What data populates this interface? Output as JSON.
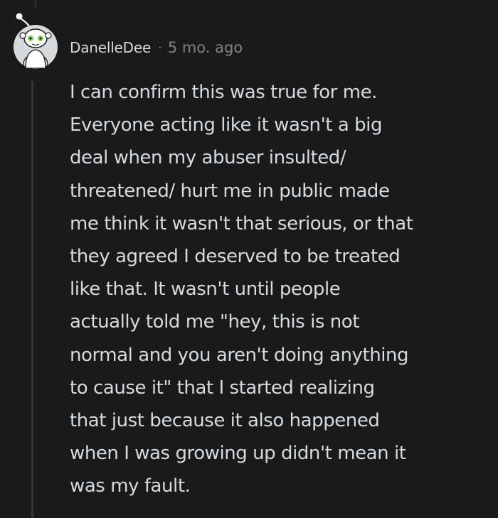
{
  "comment": {
    "author": "DanelleDee",
    "separator": "·",
    "timestamp": "5 mo. ago",
    "avatar_icon": "snoo-avatar-icon",
    "body_lines": [
      "I can confirm this was true for me.",
      "Everyone acting like it wasn't a big",
      "deal when my abuser insulted/",
      "threatened/ hurt me in public made",
      "me think it wasn't that serious, or that",
      "they agreed I deserved to be treated",
      "like that. It wasn't until people",
      "actually told me \"hey, this is not",
      "normal and you aren't doing anything",
      "to cause it\" that I started realizing",
      "that just because it also happened",
      "when I was growing up didn't mean it",
      "was my fault."
    ]
  },
  "colors": {
    "background": "#1a1a1b",
    "text": "#d7dadc",
    "meta": "#818384",
    "thread_line": "#343536",
    "avatar_eyes": "#7ed957"
  }
}
